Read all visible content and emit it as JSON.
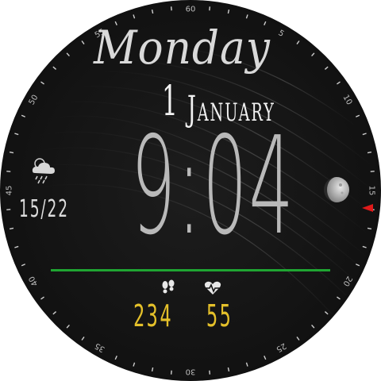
{
  "watch": {
    "day": "Monday",
    "date_number": "1",
    "month": "January",
    "time": "9:04",
    "temperature": "15/22",
    "steps": "234",
    "heart_rate": "55"
  },
  "icons": {
    "weather": "cloud-rain-icon",
    "moon": "moon-phase-icon",
    "steps": "footprints-icon",
    "heart": "heart-pulse-icon"
  },
  "dial": {
    "labels": [
      "60",
      "5",
      "10",
      "15",
      "20",
      "25",
      "30",
      "35",
      "40",
      "45",
      "50",
      "55"
    ]
  },
  "colors": {
    "accent_line": "#1fa532",
    "stats": "#e4c02a",
    "marker": "#e01a1a"
  }
}
